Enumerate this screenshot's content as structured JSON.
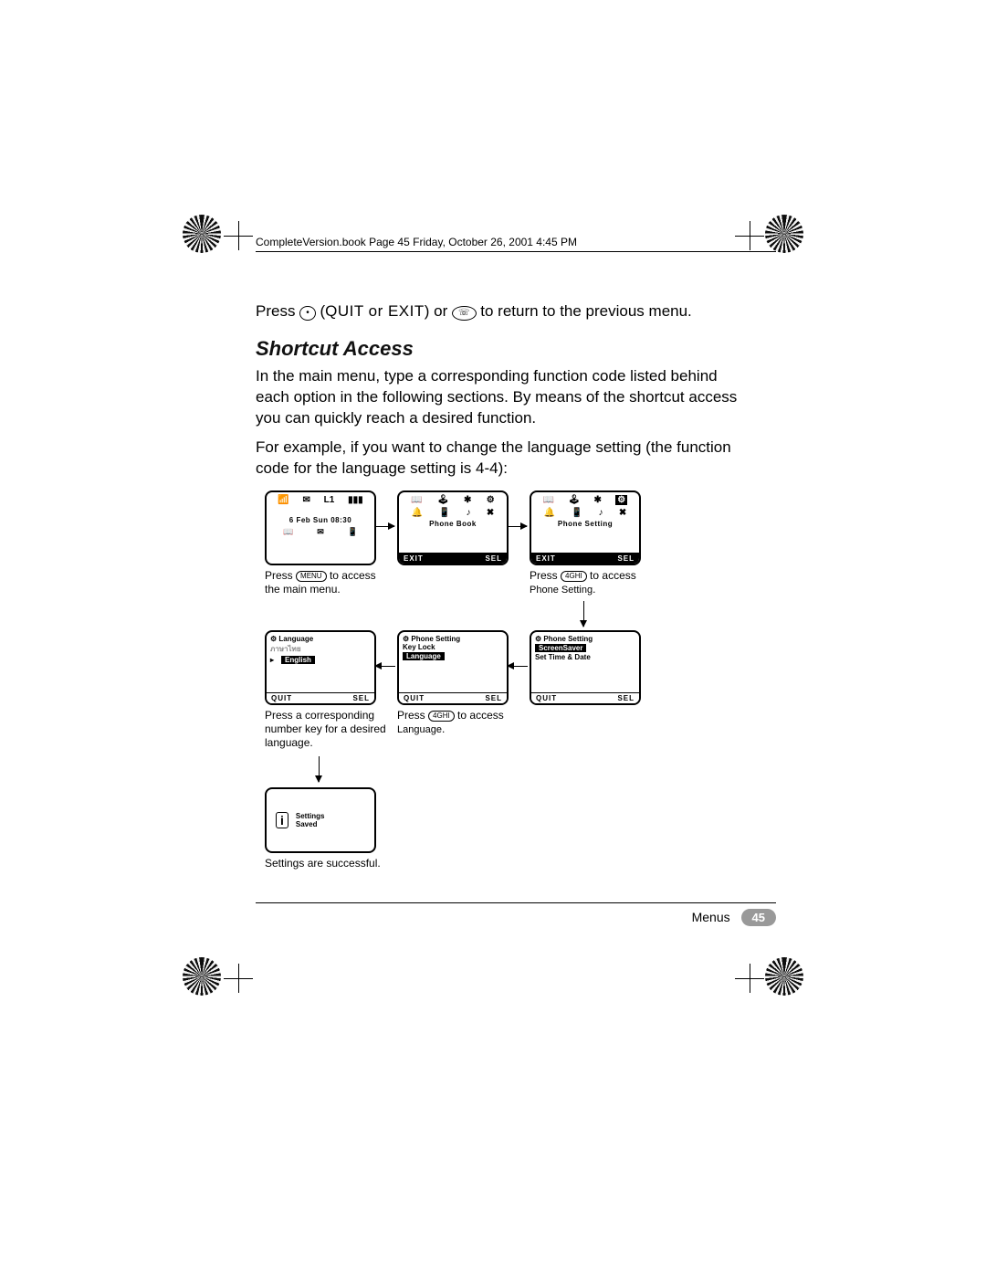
{
  "header": "CompleteVersion.book  Page 45  Friday, October 26, 2001  4:45 PM",
  "intro": {
    "press": "Press",
    "quit_exit": "QUIT or EXIT",
    "or": "or",
    "return_text": "to return to the previous menu."
  },
  "heading": "Shortcut Access",
  "para1": "In the main menu, type a corresponding function code listed behind each option in the following sections. By means of the shortcut access you can quickly reach a desired function.",
  "para2": "For example, if you want to change the language setting (the function code for the language setting is 4-4):",
  "screens": {
    "s1": {
      "top": "L1",
      "date": "6 Feb Sun 08:30",
      "caption": "Press",
      "caption_key": "MENU",
      "caption2": "to access the main menu."
    },
    "s2": {
      "title": "Phone Book",
      "exit": "EXIT",
      "sel": "SEL"
    },
    "s3": {
      "title": "Phone Setting",
      "exit": "EXIT",
      "sel": "SEL",
      "caption": "Press",
      "caption_key": "4GHI",
      "caption2": "to access",
      "caption3": "Phone Setting"
    },
    "s4": {
      "title": "Phone Setting",
      "item1": "ScreenSaver",
      "item2": "Set Time & Date",
      "quit": "QUIT",
      "sel": "SEL"
    },
    "s5": {
      "title": "Phone Setting",
      "item1": "Key Lock",
      "item2": "Language",
      "quit": "QUIT",
      "sel": "SEL",
      "caption": "Press",
      "caption_key": "4GHI",
      "caption2": "to access",
      "caption3": "Language"
    },
    "s6": {
      "title": "Language",
      "item1": "ภาษาไทย",
      "item2": "English",
      "quit": "QUIT",
      "sel": "SEL",
      "caption": "Press a corresponding number key for a desired language."
    },
    "s7": {
      "line1": "Settings",
      "line2": "Saved",
      "caption": "Settings are successful."
    }
  },
  "footer": {
    "label": "Menus",
    "page": "45"
  }
}
